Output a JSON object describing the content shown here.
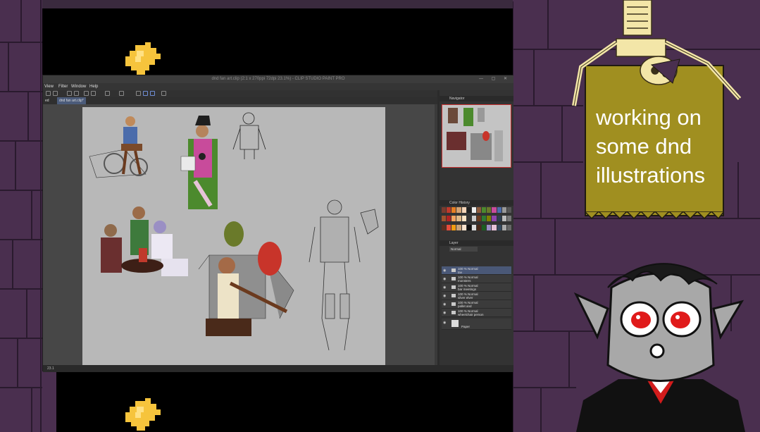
{
  "overlay": {
    "banner_text": "working on some dnd illustrations",
    "colors": {
      "wall": "#4a2f4f",
      "banner": "#a08f20",
      "flame": "#f6c43c",
      "eyes": "#e01a1a"
    },
    "icons": [
      "flame-icon",
      "skeleton-icon",
      "vampire-avatar"
    ]
  },
  "app": {
    "title": "dnd fan art.clip (2:1 x 270ppi 72dpi 23.1%) - CLIP STUDIO PAINT PRO",
    "window_buttons": "— ▢ ✕",
    "menu": [
      "View",
      "Filter",
      "Window",
      "Help"
    ],
    "tabs": [
      "ed",
      "dnd fan art.clip*"
    ],
    "panels": {
      "navigator": "Navigator",
      "color": "Color History",
      "layer": "Layer",
      "blend_mode": "Normal"
    },
    "layers": [
      {
        "opacity": "100 % Normal",
        "name": "tav"
      },
      {
        "opacity": "100 % Normal",
        "name": "monsters"
      },
      {
        "opacity": "100 % Normal",
        "name": "bar meetings"
      },
      {
        "opacity": "100 % Normal",
        "name": "silver elver"
      },
      {
        "opacity": "100 % Normal",
        "name": "pallet and"
      },
      {
        "opacity": "100 % Normal",
        "name": "wheelchair person"
      },
      {
        "opacity": "",
        "name": "Paper"
      }
    ],
    "status": "23.1"
  }
}
